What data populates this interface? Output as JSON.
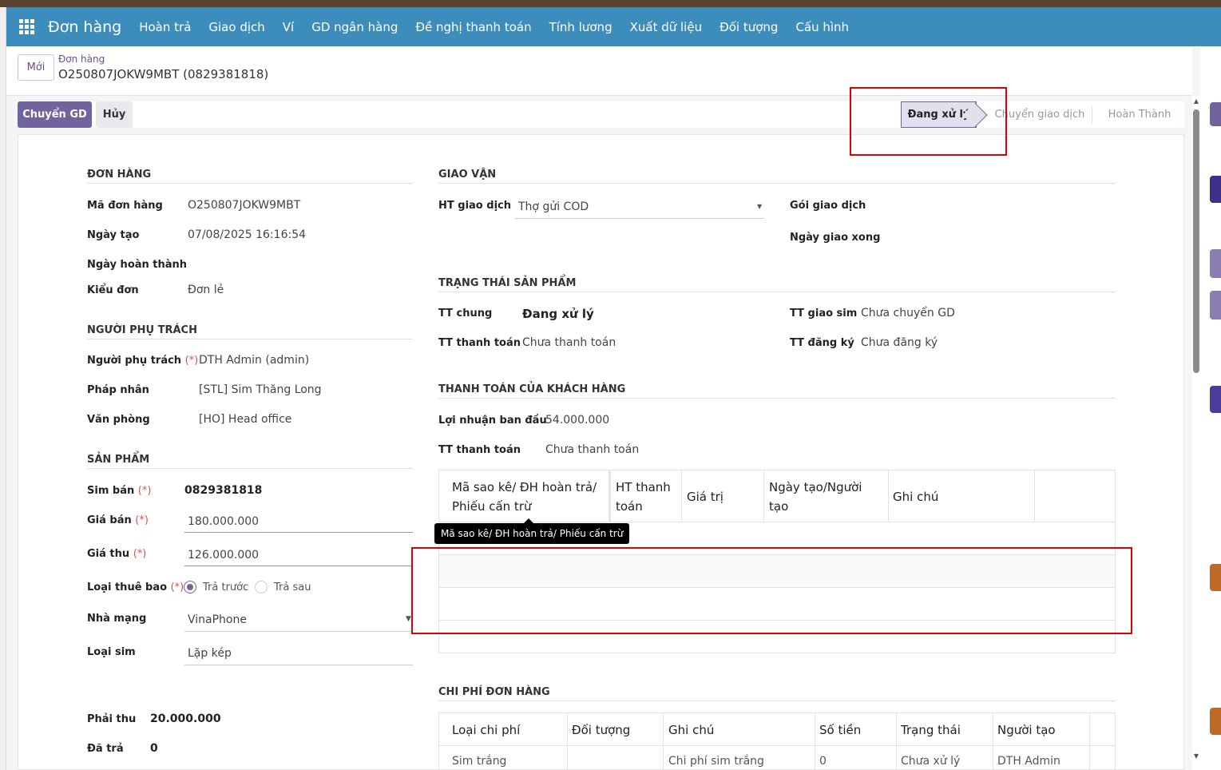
{
  "navbar": {
    "brand": "Đơn hàng",
    "menu": [
      "Hoàn trả",
      "Giao dịch",
      "Ví",
      "GD ngân hàng",
      "Đề nghị thanh toán",
      "Tính lương",
      "Xuất dữ liệu",
      "Đối tượng",
      "Cấu hình"
    ]
  },
  "control": {
    "new_label": "Mới",
    "breadcrumb_parent": "Đơn hàng",
    "breadcrumb_current": "O250807JOKW9MBT (0829381818)"
  },
  "statusbar": {
    "primary_button": "Chuyển GD",
    "cancel_button": "Hủy",
    "stages": [
      "Đang xử lý",
      "Chuyển giao dịch",
      "Hoàn Thành"
    ],
    "active_stage": "Đang xử lý"
  },
  "order": {
    "title": "ĐƠN HÀNG",
    "fields": [
      {
        "label": "Mã đơn hàng",
        "value": "O250807JOKW9MBT"
      },
      {
        "label": "Ngày tạo",
        "value": "07/08/2025 16:16:54"
      },
      {
        "label": "Ngày hoàn thành",
        "value": ""
      },
      {
        "label": "Kiểu đơn",
        "value": "Đơn lẻ"
      }
    ]
  },
  "responsible": {
    "title": "NGƯỜI PHỤ TRÁCH",
    "fields": [
      {
        "label": "Người phụ trách",
        "required": "(*)",
        "value": "DTH Admin (admin)"
      },
      {
        "label": "Pháp nhân",
        "value": "[STL] Sim Thăng Long"
      },
      {
        "label": "Văn phòng",
        "value": "[HO] Head office"
      }
    ]
  },
  "product": {
    "title": "SẢN PHẨM",
    "sim_label": "Sim bán",
    "sim_value": "0829381818",
    "price_label": "Giá bán",
    "price_value": "180.000.000",
    "collect_label": "Giá thu",
    "collect_value": "126.000.000",
    "subscription_label": "Loại thuê bao",
    "subscription_options": [
      "Trả trước",
      "Trả sau"
    ],
    "subscription_selected": "Trả trước",
    "network_label": "Nhà mạng",
    "network_value": "VinaPhone",
    "simtype_label": "Loại sim",
    "simtype_value": "Lặp kép",
    "required_mark": "(*)"
  },
  "totals": {
    "receivable_label": "Phải thu",
    "receivable_value": "20.000.000",
    "paid_label": "Đã trả",
    "paid_value": "0"
  },
  "shipping": {
    "title": "GIAO VẬN",
    "method_label": "HT giao dịch",
    "method_value": "Thợ gửi COD",
    "package_label": "Gói giao dịch",
    "delivered_label": "Ngày giao xong"
  },
  "product_status": {
    "title": "TRẠNG THÁI SẢN PHẨM",
    "general_label": "TT chung",
    "general_value": "Đang xử lý",
    "payment_label": "TT thanh toán",
    "payment_value": "Chưa thanh toán",
    "sim_delivery_label": "TT giao sim",
    "sim_delivery_value": "Chưa chuyển GD",
    "registration_label": "TT đăng ký",
    "registration_value": "Chưa đăng ký"
  },
  "customer_payment": {
    "title": "THANH TOÁN CỦA KHÁCH HÀNG",
    "profit_label": "Lợi nhuận ban đầu",
    "profit_value": "54.000.000",
    "payment_label": "TT thanh toán",
    "payment_value": "Chưa thanh toán",
    "columns": [
      "Mã sao kê/ ĐH hoàn trả/ Phiếu cấn trừ",
      "HT thanh toán",
      "Giá trị",
      "Ngày tạo/Người tạo",
      "Ghi chú"
    ],
    "tooltip": "Mã sao kê/ ĐH hoàn trả/ Phiếu cấn trừ"
  },
  "costs": {
    "title": "CHI PHÍ ĐƠN HÀNG",
    "columns": [
      "Loại chi phí",
      "Đối tượng",
      "Ghi chú",
      "Số tiền",
      "Trạng thái",
      "Người tạo"
    ],
    "rows": [
      [
        "Sim trắng",
        "",
        "Chi phí sim trắng",
        "0",
        "Chưa xử lý",
        "DTH Admin"
      ]
    ]
  },
  "colors": {
    "navbar": "#3c8dbc",
    "primary": "#71639e",
    "highlight": "#e00000"
  }
}
